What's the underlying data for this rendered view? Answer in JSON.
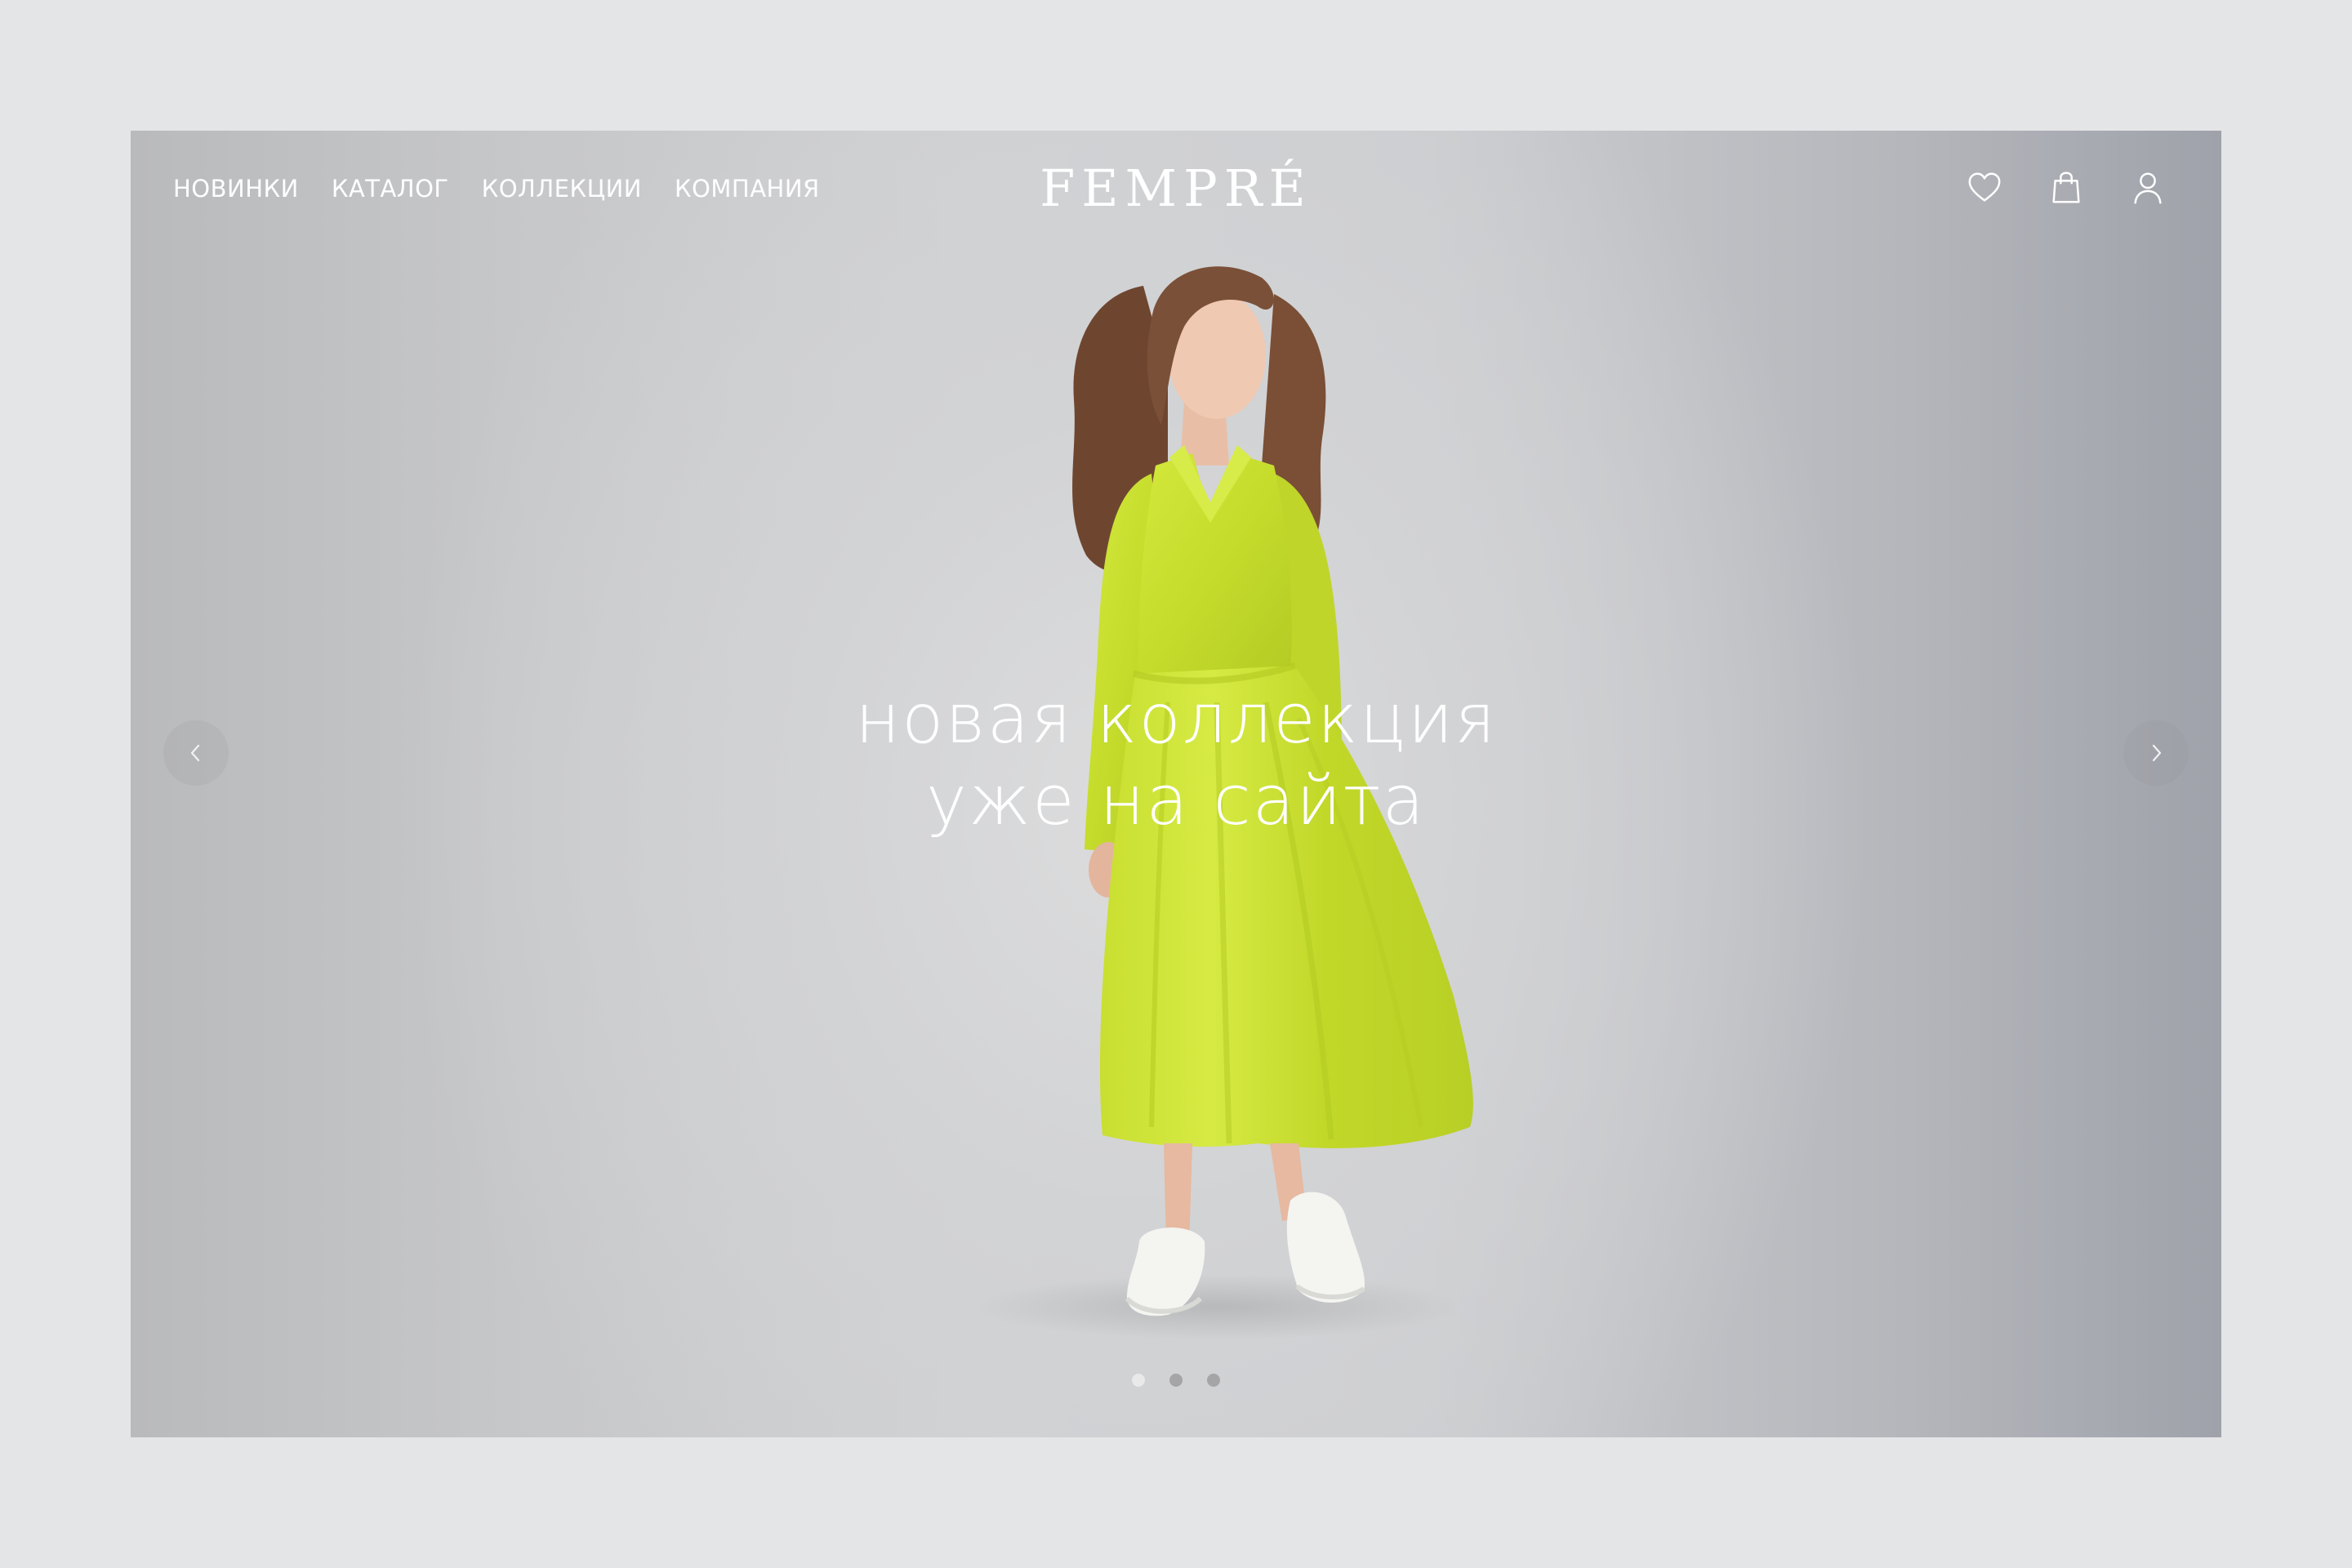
{
  "header": {
    "nav": [
      {
        "label": "НОВИНКИ"
      },
      {
        "label": "КАТАЛОГ"
      },
      {
        "label": "КОЛЛЕКЦИИ"
      },
      {
        "label": "КОМПАНИЯ"
      }
    ],
    "logo": "FEMPRÉ",
    "icons": [
      "heart-icon",
      "shopping-bag-icon",
      "user-icon"
    ]
  },
  "hero": {
    "headline_line1": "новая коллекция",
    "headline_line2": "уже на сайта",
    "dress_color": "#c9e030",
    "slides_total": 3,
    "active_slide": 1
  },
  "colors": {
    "page_background": "#e4e5e7",
    "text": "#ffffff"
  }
}
